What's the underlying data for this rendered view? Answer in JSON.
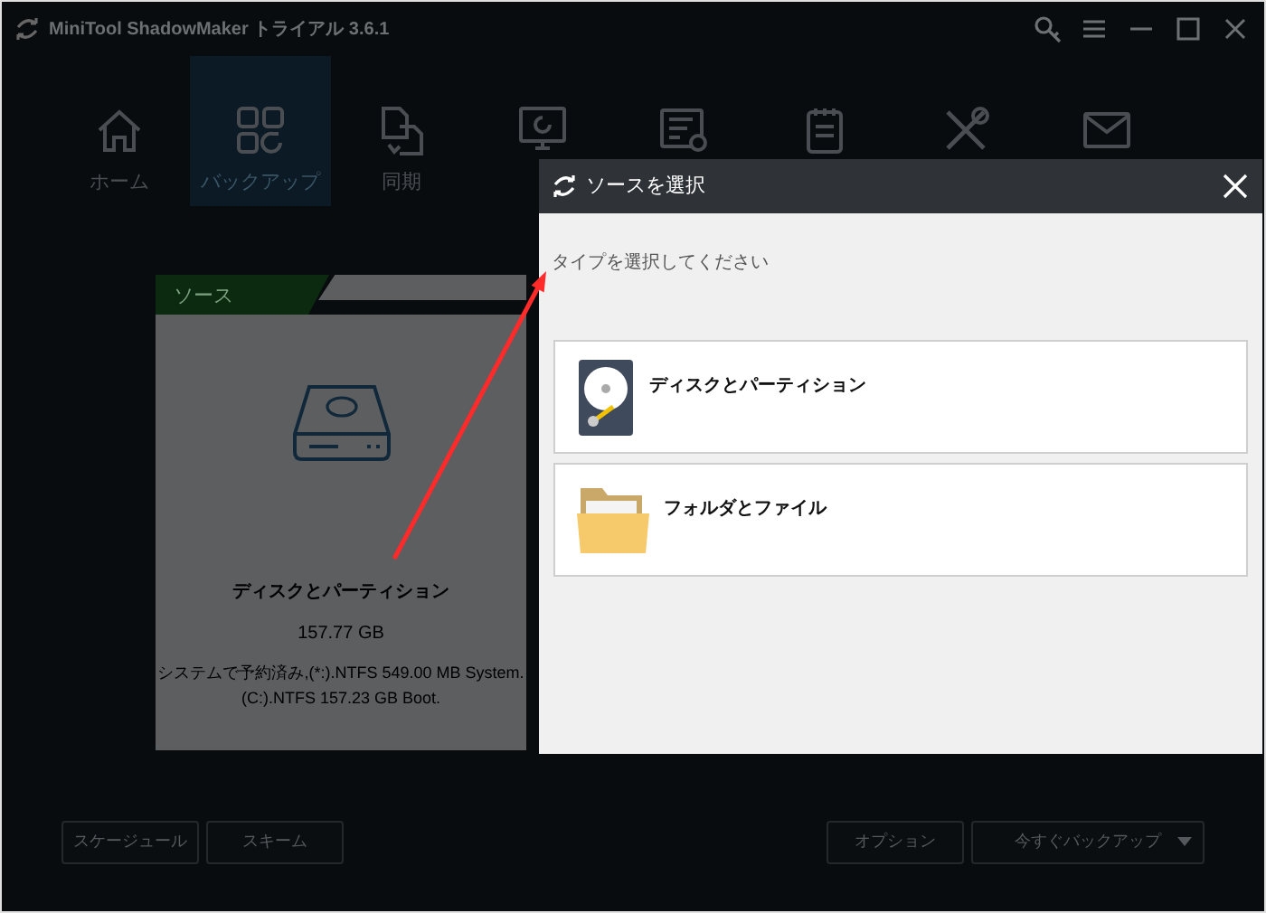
{
  "window": {
    "title": "MiniTool ShadowMaker トライアル 3.6.1",
    "controls": [
      {
        "kind": "key"
      },
      {
        "kind": "menu"
      },
      {
        "kind": "minimize"
      },
      {
        "kind": "maximize"
      },
      {
        "kind": "close"
      }
    ]
  },
  "nav": [
    {
      "kind": "home",
      "label": "ホーム",
      "selected": false
    },
    {
      "kind": "backup",
      "label": "バックアップ",
      "selected": true
    },
    {
      "kind": "sync",
      "label": "同期",
      "selected": false
    },
    {
      "kind": "restore",
      "selected": false
    },
    {
      "kind": "list",
      "selected": false
    },
    {
      "kind": "notepad",
      "selected": false
    },
    {
      "kind": "tools",
      "selected": false
    },
    {
      "kind": "mail",
      "selected": false
    }
  ],
  "source": {
    "tab": "ソース",
    "title": "ディスクとパーティション",
    "size": "157.77 GB",
    "details": [
      "システムで予約済み,(*:).NTFS 549.00 MB System.",
      "(C:).NTFS 157.23 GB Boot."
    ]
  },
  "bottom_left": [
    "スケージュール",
    "スキーム"
  ],
  "bottom_right": [
    {
      "label": "オプション",
      "dropdown": false
    },
    {
      "label": "今すぐバックアップ",
      "dropdown": true
    }
  ],
  "dialog": {
    "title": "ソースを選択",
    "prompt": "タイプを選択してください",
    "options": [
      {
        "kind": "disk",
        "label": "ディスクとパーティション"
      },
      {
        "kind": "folder",
        "label": "フォルダとファイル"
      }
    ]
  },
  "annotations": [
    {
      "kind": "arrow"
    }
  ]
}
